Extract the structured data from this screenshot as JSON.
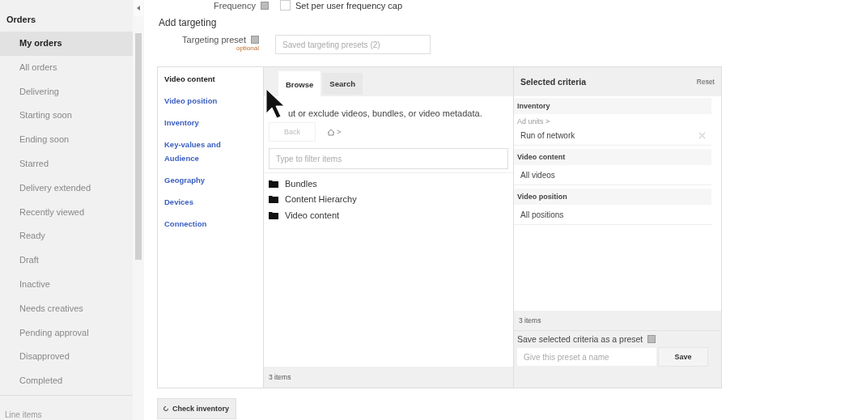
{
  "sidebar": {
    "title": "Orders",
    "items": [
      {
        "label": "My orders",
        "selected": true
      },
      {
        "label": "All orders",
        "selected": false
      },
      {
        "label": "Delivering",
        "selected": false
      },
      {
        "label": "Starting soon",
        "selected": false
      },
      {
        "label": "Ending soon",
        "selected": false
      },
      {
        "label": "Starred",
        "selected": false
      },
      {
        "label": "Delivery extended",
        "selected": false
      },
      {
        "label": "Recently viewed",
        "selected": false
      },
      {
        "label": "Ready",
        "selected": false
      },
      {
        "label": "Draft",
        "selected": false
      },
      {
        "label": "Inactive",
        "selected": false
      },
      {
        "label": "Needs creatives",
        "selected": false
      },
      {
        "label": "Pending approval",
        "selected": false
      },
      {
        "label": "Disapproved",
        "selected": false
      },
      {
        "label": "Completed",
        "selected": false
      }
    ],
    "footer": "Line items"
  },
  "frequency": {
    "label": "Frequency",
    "checkbox_label": "Set per user frequency cap",
    "checked": false
  },
  "section_title": "Add targeting",
  "targeting_preset": {
    "label": "Targeting preset",
    "hint": "optional",
    "placeholder": "Saved targeting presets (2)"
  },
  "categories": [
    {
      "label": "Video content",
      "selected": true
    },
    {
      "label": "Video position",
      "selected": false
    },
    {
      "label": "Inventory",
      "selected": false
    },
    {
      "label": "Key-values and Audience",
      "selected": false
    },
    {
      "label": "Geography",
      "selected": false
    },
    {
      "label": "Devices",
      "selected": false
    },
    {
      "label": "Connection",
      "selected": false
    }
  ],
  "browser": {
    "tabs": [
      {
        "label": "Browse",
        "selected": true
      },
      {
        "label": "Search",
        "selected": false
      }
    ],
    "description": "ut or exclude videos, bundles, or video metadata.",
    "back": "Back",
    "breadcrumb": ">",
    "filter_placeholder": "Type to filter items",
    "items": [
      "Bundles",
      "Content Hierarchy",
      "Video content"
    ],
    "count": "3 items"
  },
  "selected_criteria": {
    "title": "Selected criteria",
    "reset": "Reset",
    "groups": [
      {
        "title": "Inventory",
        "path": "Ad units >",
        "values": [
          {
            "label": "Run of network",
            "removable": true
          }
        ]
      },
      {
        "title": "Video content",
        "values": [
          {
            "label": "All videos",
            "removable": false
          }
        ]
      },
      {
        "title": "Video position",
        "values": [
          {
            "label": "All positions",
            "removable": false
          }
        ]
      }
    ],
    "count": "3 items",
    "save_label": "Save selected criteria as a preset",
    "save_placeholder": "Give this preset a name",
    "save_button": "Save"
  },
  "check_inventory": "Check inventory"
}
